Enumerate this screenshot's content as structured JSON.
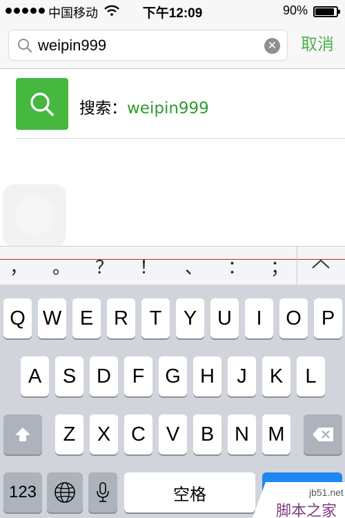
{
  "status_bar": {
    "carrier": "中国移动",
    "time": "下午12:09",
    "battery_percent": "90%",
    "battery_level": 0.9,
    "signal_bars": 5
  },
  "search": {
    "query": "weipin999",
    "cancel_label": "取消"
  },
  "result": {
    "prefix": "搜索：",
    "keyword": "weipin999"
  },
  "candidates": [
    "，",
    "。",
    "？",
    "！",
    "、",
    "：",
    "；"
  ],
  "keyboard": {
    "row1": [
      "Q",
      "W",
      "E",
      "R",
      "T",
      "Y",
      "U",
      "I",
      "O",
      "P"
    ],
    "row2": [
      "A",
      "S",
      "D",
      "F",
      "G",
      "H",
      "J",
      "K",
      "L"
    ],
    "row3": [
      "Z",
      "X",
      "C",
      "V",
      "B",
      "N",
      "M"
    ],
    "numbers_label": "123",
    "space_label": "空格"
  },
  "watermark": {
    "site": "jb51.net",
    "brand": "脚本之家"
  },
  "colors": {
    "accent_green": "#4db34d",
    "icon_green": "#46b73f",
    "keyboard_bg": "#d1d5db",
    "return_key_blue": "#1e88f0"
  }
}
